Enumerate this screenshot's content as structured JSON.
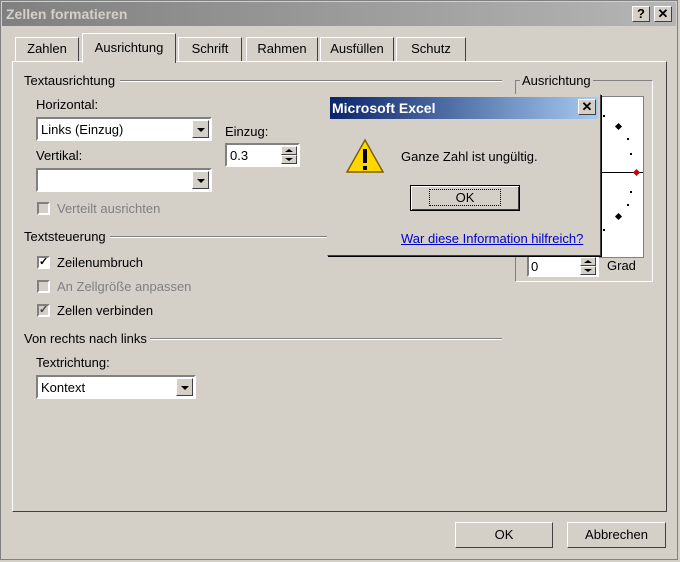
{
  "window": {
    "title": "Zellen formatieren",
    "help": "?",
    "close": "✕"
  },
  "tabs": [
    "Zahlen",
    "Ausrichtung",
    "Schrift",
    "Rahmen",
    "Ausfüllen",
    "Schutz"
  ],
  "text_alignment": {
    "group": "Textausrichtung",
    "horizontal_label": "Horizontal:",
    "horizontal_value": "Links (Einzug)",
    "indent_label": "Einzug:",
    "indent_value": "0.3",
    "vertical_label": "Vertikal:",
    "vertical_value": "",
    "distributed": "Verteilt ausrichten"
  },
  "text_control": {
    "group": "Textsteuerung",
    "wrap": "Zeilenumbruch",
    "shrink": "An Zellgröße anpassen",
    "merge": "Zellen verbinden"
  },
  "rtl": {
    "group": "Von rechts nach links",
    "direction_label": "Textrichtung:",
    "direction_value": "Kontext"
  },
  "orientation": {
    "group": "Ausrichtung",
    "degrees_value": "0",
    "degrees_label": "Grad"
  },
  "footer": {
    "ok": "OK",
    "cancel": "Abbrechen"
  },
  "msgbox": {
    "title": "Microsoft Excel",
    "close": "✕",
    "text": "Ganze Zahl ist ungültig.",
    "ok": "OK",
    "link": "War diese Information hilfreich?"
  },
  "colors": {
    "active_title": "#0a246a",
    "inactive_title": "#808080",
    "face": "#d4d0c8",
    "link": "#0000cc",
    "accent_red": "#cc0000"
  },
  "icons": {
    "warning": "warning-icon"
  }
}
